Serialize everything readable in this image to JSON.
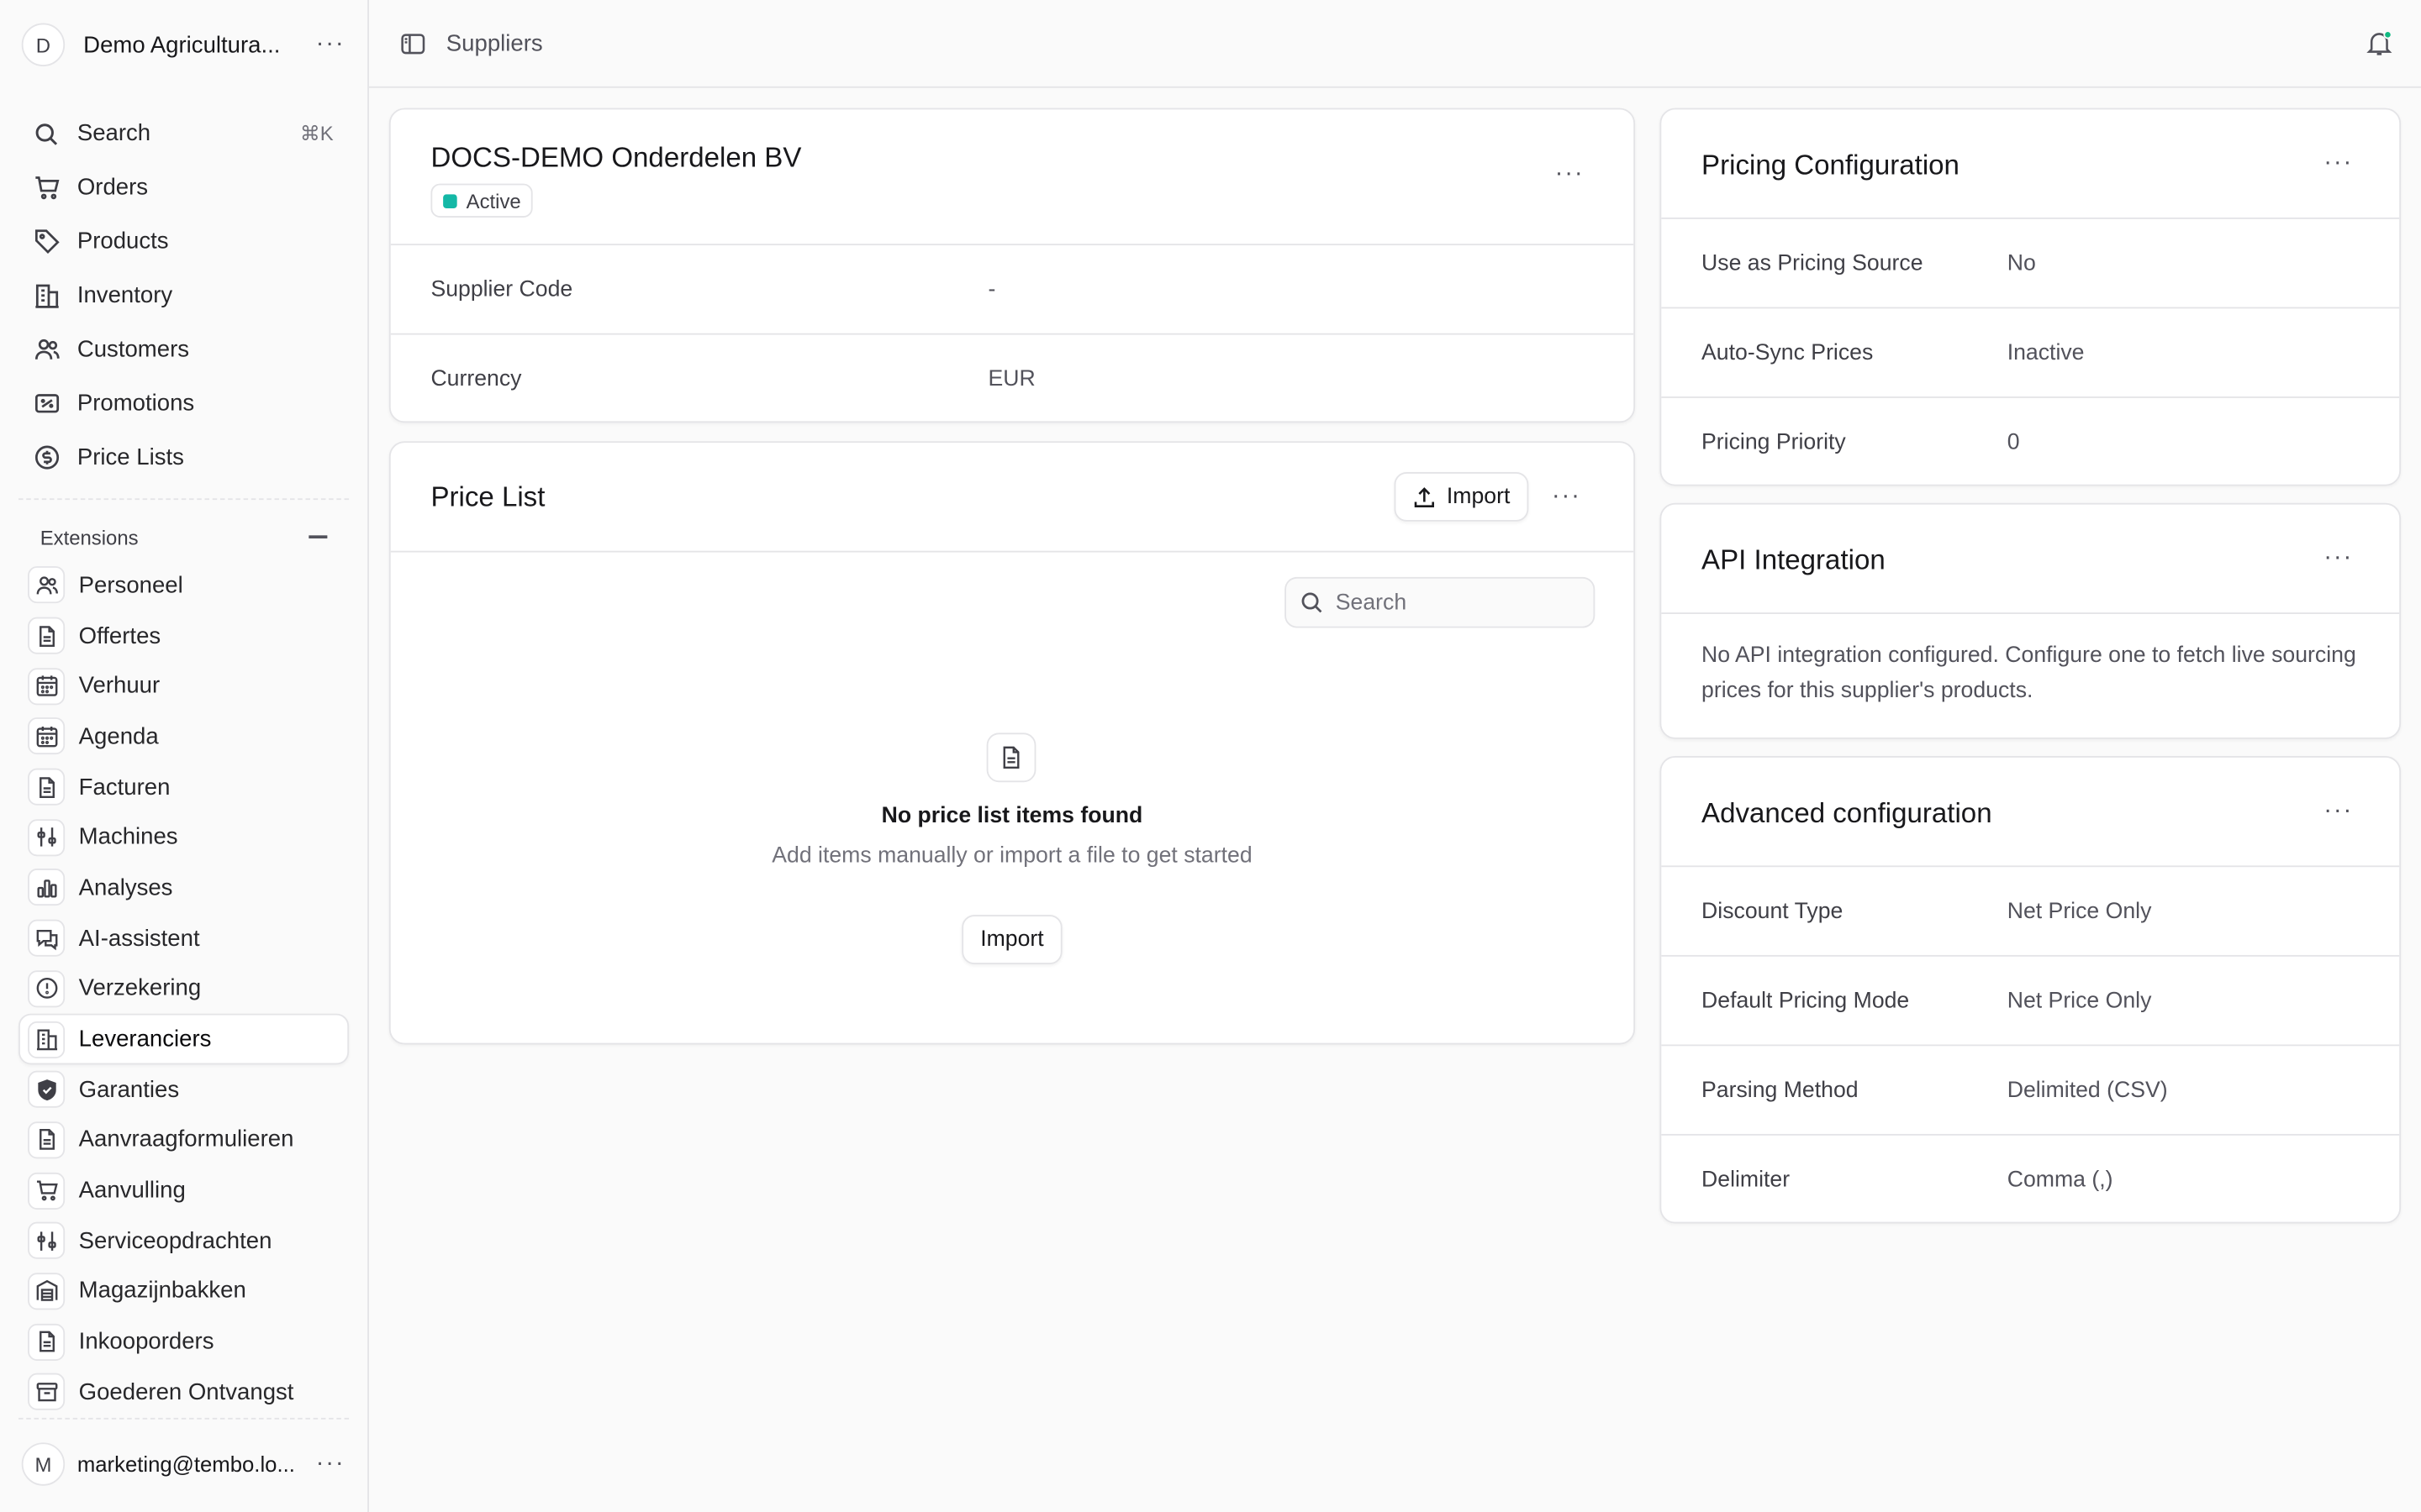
{
  "org": {
    "initial": "D",
    "name": "Demo Agricultura..."
  },
  "nav": {
    "search_label": "Search",
    "search_shortcut": "⌘K",
    "items": [
      {
        "label": "Orders",
        "icon": "cart-icon"
      },
      {
        "label": "Products",
        "icon": "tag-icon"
      },
      {
        "label": "Inventory",
        "icon": "building-icon"
      },
      {
        "label": "Customers",
        "icon": "users-icon"
      },
      {
        "label": "Promotions",
        "icon": "ticket-icon"
      },
      {
        "label": "Price Lists",
        "icon": "dollar-circle-icon"
      }
    ]
  },
  "extensions": {
    "heading": "Extensions",
    "items": [
      {
        "label": "Personeel",
        "icon": "users-icon"
      },
      {
        "label": "Offertes",
        "icon": "document-icon"
      },
      {
        "label": "Verhuur",
        "icon": "calendar-icon"
      },
      {
        "label": "Agenda",
        "icon": "calendar-icon"
      },
      {
        "label": "Facturen",
        "icon": "document-icon"
      },
      {
        "label": "Machines",
        "icon": "tools-icon"
      },
      {
        "label": "Analyses",
        "icon": "bar-chart-icon"
      },
      {
        "label": "AI-assistent",
        "icon": "chat-icon"
      },
      {
        "label": "Verzekering",
        "icon": "alert-circle-icon"
      },
      {
        "label": "Leveranciers",
        "icon": "building-icon",
        "active": true
      },
      {
        "label": "Garanties",
        "icon": "shield-check-icon"
      },
      {
        "label": "Aanvraagformulieren",
        "icon": "document-icon"
      },
      {
        "label": "Aanvulling",
        "icon": "cart-icon"
      },
      {
        "label": "Serviceopdrachten",
        "icon": "tools-icon"
      },
      {
        "label": "Magazijnbakken",
        "icon": "warehouse-icon"
      },
      {
        "label": "Inkooporders",
        "icon": "document-icon"
      },
      {
        "label": "Goederen Ontvangst",
        "icon": "archive-icon"
      }
    ]
  },
  "user": {
    "initial": "M",
    "email": "marketing@tembo.lo..."
  },
  "header": {
    "breadcrumb": "Suppliers"
  },
  "supplier": {
    "name": "DOCS-DEMO Onderdelen BV",
    "status": "Active",
    "status_color": "#14b8a6",
    "fields": [
      {
        "label": "Supplier Code",
        "value": "-"
      },
      {
        "label": "Currency",
        "value": "EUR"
      }
    ]
  },
  "price_list": {
    "title": "Price List",
    "import_label": "Import",
    "search_placeholder": "Search",
    "empty_title": "No price list items found",
    "empty_subtitle": "Add items manually or import a file to get started",
    "empty_import_label": "Import"
  },
  "pricing_config": {
    "title": "Pricing Configuration",
    "fields": [
      {
        "label": "Use as Pricing Source",
        "value": "No"
      },
      {
        "label": "Auto-Sync Prices",
        "value": "Inactive"
      },
      {
        "label": "Pricing Priority",
        "value": "0"
      }
    ]
  },
  "api_integration": {
    "title": "API Integration",
    "description": "No API integration configured. Configure one to fetch live sourcing prices for this supplier's products."
  },
  "advanced_config": {
    "title": "Advanced configuration",
    "fields": [
      {
        "label": "Discount Type",
        "value": "Net Price Only"
      },
      {
        "label": "Default Pricing Mode",
        "value": "Net Price Only"
      },
      {
        "label": "Parsing Method",
        "value": "Delimited (CSV)"
      },
      {
        "label": "Delimiter",
        "value": "Comma (,)"
      }
    ]
  },
  "colors": {
    "accent": "#14b8a6",
    "notification_dot": "#10b981"
  }
}
